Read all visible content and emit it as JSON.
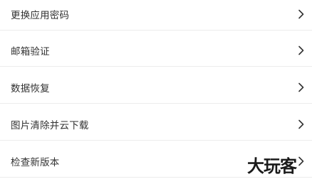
{
  "settings": {
    "items": [
      {
        "label": "更换应用密码",
        "icon": "chevron-right-icon"
      },
      {
        "label": "邮箱验证",
        "icon": "chevron-right-icon"
      },
      {
        "label": "数据恢复",
        "icon": "chevron-right-icon"
      },
      {
        "label": "图片清除并云下载",
        "icon": "chevron-right-icon"
      },
      {
        "label": "检查新版本",
        "icon": "chevron-right-icon"
      }
    ]
  },
  "watermark": {
    "text": "大玩客"
  },
  "colors": {
    "background": "#ffffff",
    "text": "#333333",
    "divider": "#ececec",
    "chevron": "#333333"
  }
}
